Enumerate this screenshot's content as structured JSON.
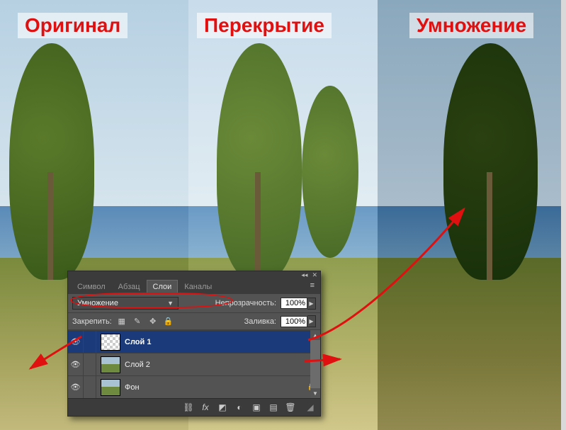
{
  "labels": {
    "original": "Оригинал",
    "overlay": "Перекрытие",
    "multiply": "Умножение"
  },
  "panel": {
    "tabs": {
      "symbol": "Символ",
      "paragraph": "Абзац",
      "layers": "Слои",
      "channels": "Каналы"
    },
    "blend_mode": "Умножение",
    "opacity_label": "Непрозрачность:",
    "opacity_value": "100%",
    "lock_label": "Закрепить:",
    "fill_label": "Заливка:",
    "fill_value": "100%",
    "layers": [
      {
        "name": "Слой 1",
        "selected": true,
        "thumb": "checker",
        "locked": false
      },
      {
        "name": "Слой 2",
        "selected": false,
        "thumb": "img",
        "locked": false
      },
      {
        "name": "Фон",
        "selected": false,
        "thumb": "img",
        "locked": true
      }
    ],
    "footer_icons": {
      "link": "link-icon",
      "fx": "fx",
      "mask": "mask-icon",
      "adjust": "adjustment-icon",
      "group": "group-icon",
      "new": "new-layer-icon",
      "trash": "trash-icon"
    }
  }
}
